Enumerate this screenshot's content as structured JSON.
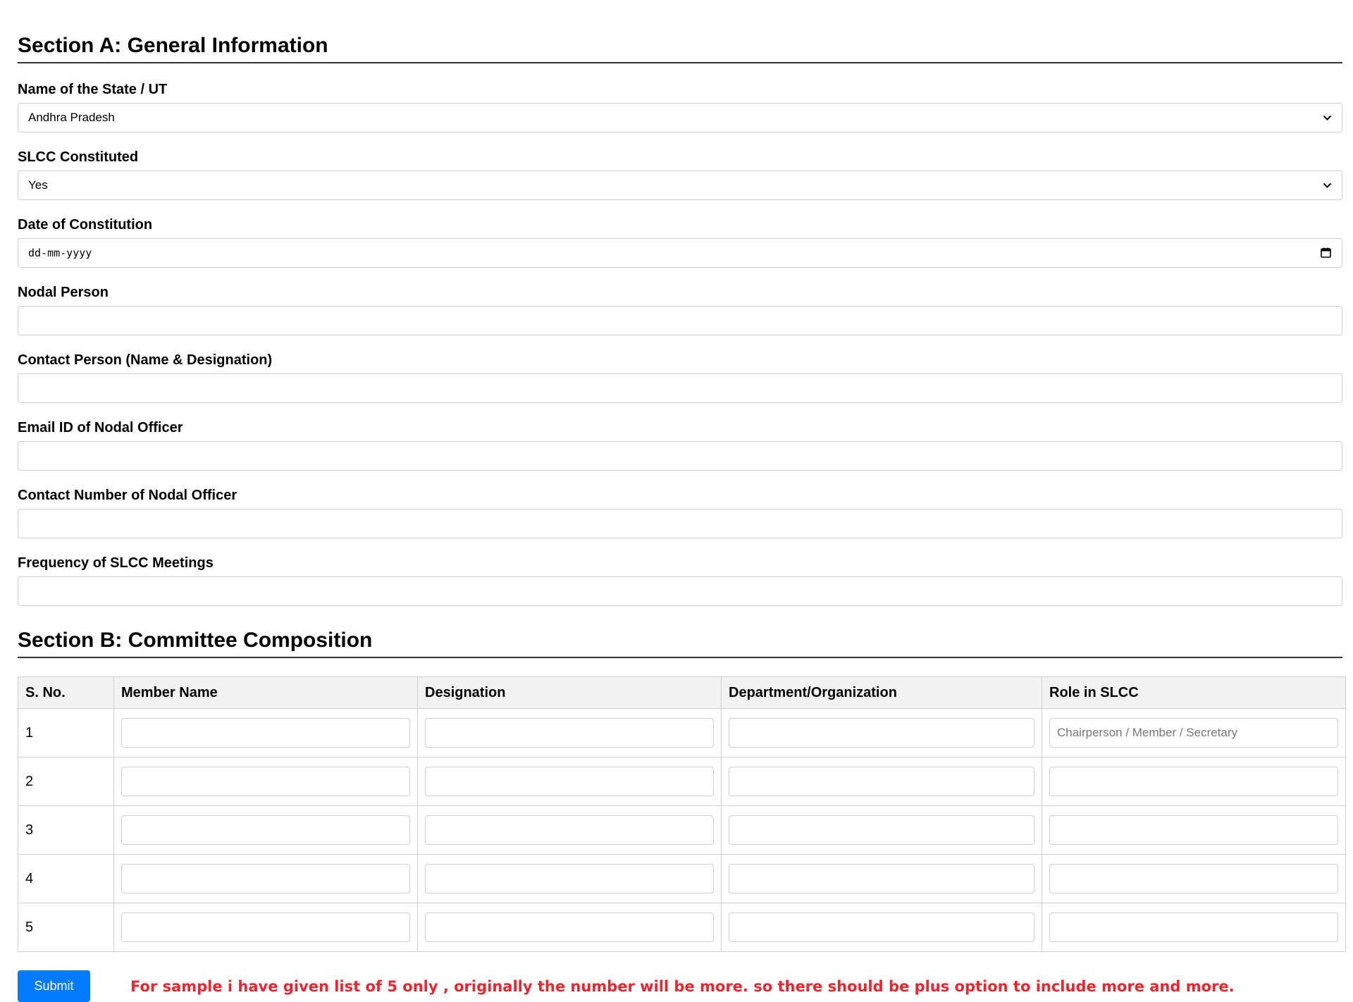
{
  "section_a": {
    "title": "Section A: General Information",
    "state": {
      "label": "Name of the State / UT",
      "value": "Andhra Pradesh"
    },
    "slcc_constituted": {
      "label": "SLCC Constituted",
      "value": "Yes"
    },
    "date_of_constitution": {
      "label": "Date of Constitution",
      "value": "dd-mm-yyyy"
    },
    "nodal_person": {
      "label": "Nodal Person",
      "value": ""
    },
    "contact_person": {
      "label": "Contact Person (Name & Designation)",
      "value": ""
    },
    "email": {
      "label": "Email ID of Nodal Officer",
      "value": ""
    },
    "contact_number": {
      "label": "Contact Number of Nodal Officer",
      "value": ""
    },
    "frequency": {
      "label": "Frequency of SLCC Meetings",
      "value": ""
    }
  },
  "section_b": {
    "title": "Section B: Committee Composition",
    "columns": [
      "S. No.",
      "Member Name",
      "Designation",
      "Department/Organization",
      "Role in SLCC"
    ],
    "role_placeholder": "Chairperson / Member / Secretary",
    "rows": [
      {
        "sno": "1"
      },
      {
        "sno": "2"
      },
      {
        "sno": "3"
      },
      {
        "sno": "4"
      },
      {
        "sno": "5"
      }
    ]
  },
  "footer": {
    "submit_label": "Submit",
    "note": "For sample i have given list of 5 only , originally the number will be more. so there should be plus option to include more and more.",
    "note_color": "#e8262f",
    "submit_color": "#007bff"
  },
  "icons": {
    "select": "chevron-down-icon",
    "date": "calendar-icon"
  }
}
